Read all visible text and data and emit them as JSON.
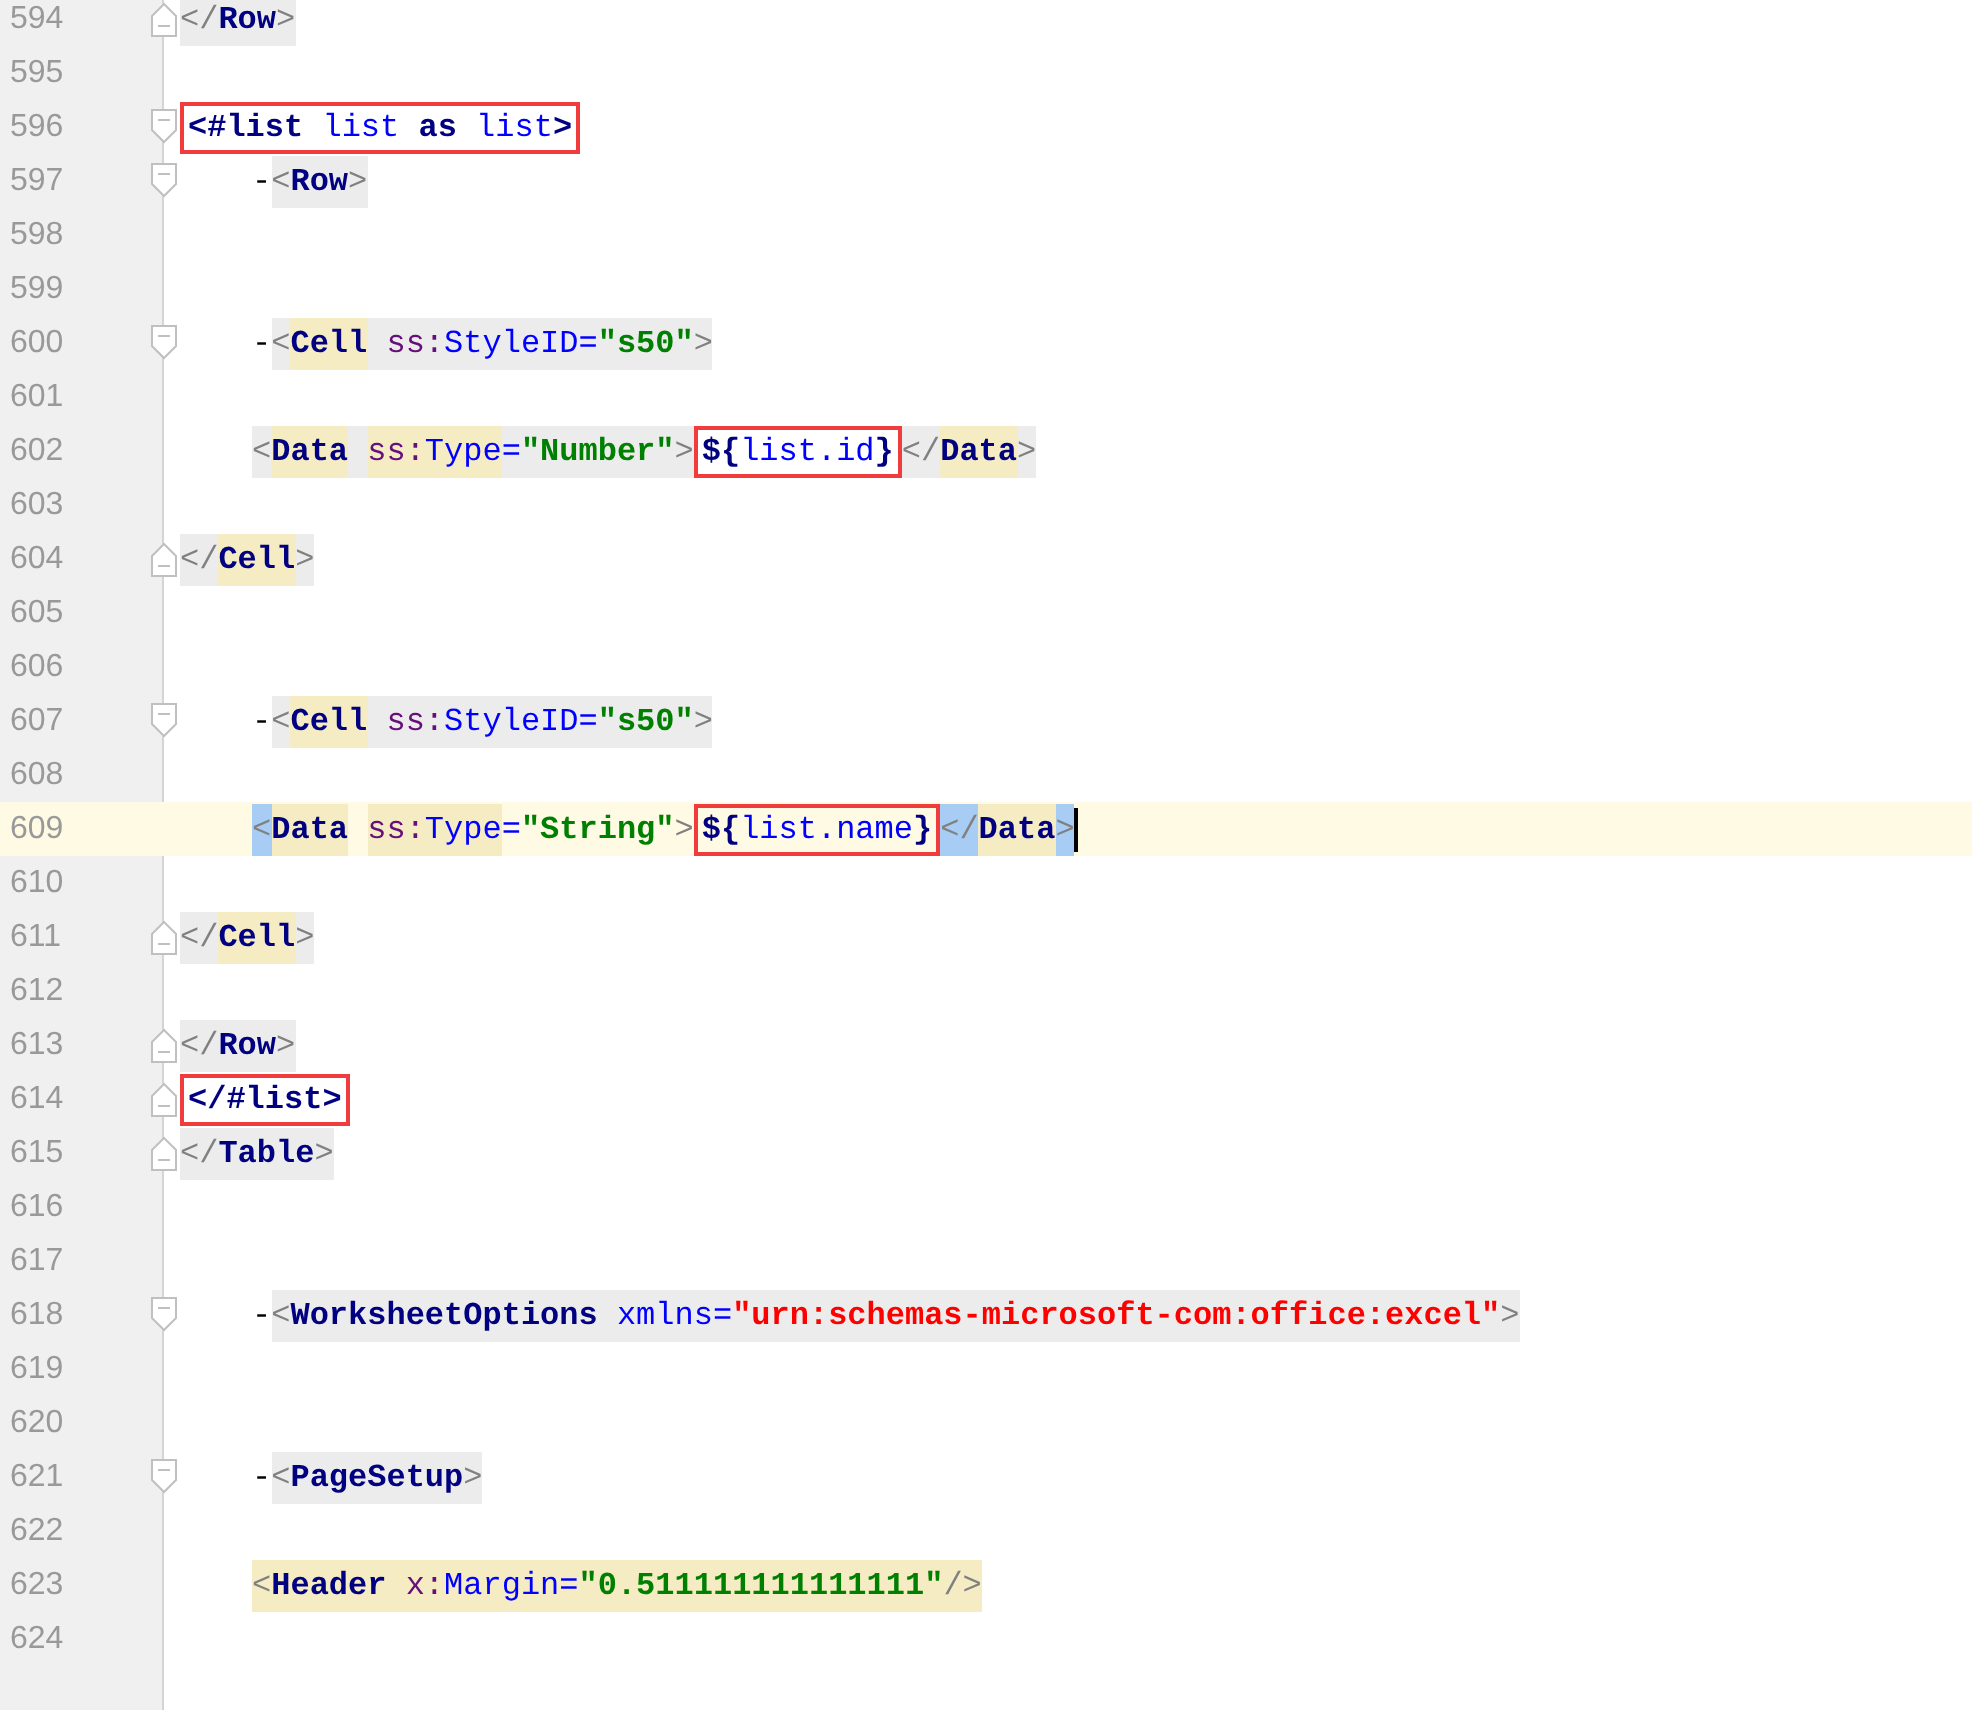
{
  "lines": [
    {
      "number": "594",
      "fold_close": true,
      "segments": [
        {
          "kind": "tag",
          "tokens": [
            {
              "text": "</",
              "kind": "punct"
            },
            {
              "text": "Row",
              "kind": "tag"
            },
            {
              "text": ">",
              "kind": "punct"
            }
          ]
        }
      ]
    },
    {
      "number": "595"
    },
    {
      "number": "596",
      "fold_open": true,
      "segments": [
        {
          "kind": "text",
          "boxed": true,
          "tokens": [
            {
              "text": "<#list ",
              "kind": "dir"
            },
            {
              "text": "list ",
              "kind": "expr"
            },
            {
              "text": "as ",
              "kind": "dir"
            },
            {
              "text": "list",
              "kind": "expr"
            },
            {
              "text": ">",
              "kind": "dir"
            }
          ]
        }
      ]
    },
    {
      "number": "597",
      "fold_open": true,
      "indented": true,
      "segments": [
        {
          "kind": "text",
          "tokens": [
            {
              "text": "-",
              "kind": "dash"
            }
          ]
        },
        {
          "kind": "tag",
          "tokens": [
            {
              "text": "<",
              "kind": "punct"
            },
            {
              "text": "Row",
              "kind": "tag"
            },
            {
              "text": ">",
              "kind": "punct"
            }
          ]
        }
      ]
    },
    {
      "number": "598"
    },
    {
      "number": "599"
    },
    {
      "number": "600",
      "fold_open": true,
      "indented": true,
      "segments": [
        {
          "kind": "text",
          "tokens": [
            {
              "text": "-",
              "kind": "dash"
            }
          ]
        },
        {
          "kind": "tag",
          "tokens": [
            {
              "text": "<",
              "kind": "punct"
            },
            {
              "text": "Cell",
              "kind": "tag",
              "matched": true
            },
            {
              "text": " ss:",
              "kind": "ns"
            },
            {
              "text": "StyleID=",
              "kind": "attr"
            },
            {
              "text": "\"s50\"",
              "kind": "value"
            },
            {
              "text": ">",
              "kind": "punct"
            }
          ]
        }
      ]
    },
    {
      "number": "601"
    },
    {
      "number": "602",
      "indented": true,
      "segments": [
        {
          "kind": "tag",
          "tokens": [
            {
              "text": "<",
              "kind": "punct"
            },
            {
              "text": "Data",
              "kind": "tag",
              "matched": true
            },
            {
              "text": "ss:",
              "kind": "ns",
              "matched": true,
              "spaced": true
            },
            {
              "text": "Type",
              "kind": "attr",
              "matched": true
            },
            {
              "text": "=",
              "kind": "attr"
            },
            {
              "text": "\"Number\"",
              "kind": "value"
            },
            {
              "text": ">",
              "kind": "punct"
            }
          ]
        },
        {
          "kind": "text",
          "boxed": true,
          "tokens": [
            {
              "text": "${",
              "kind": "dir"
            },
            {
              "text": "list.id",
              "kind": "expr"
            },
            {
              "text": "}",
              "kind": "dir"
            }
          ]
        },
        {
          "kind": "tag",
          "tokens": [
            {
              "text": "</",
              "kind": "punct"
            },
            {
              "text": "Data",
              "kind": "tag",
              "matched": true
            },
            {
              "text": ">",
              "kind": "punct"
            }
          ]
        }
      ]
    },
    {
      "number": "603"
    },
    {
      "number": "604",
      "fold_close": true,
      "segments": [
        {
          "kind": "tag",
          "tokens": [
            {
              "text": "</",
              "kind": "punct"
            },
            {
              "text": "Cell",
              "kind": "tag",
              "matched": true
            },
            {
              "text": ">",
              "kind": "punct"
            }
          ]
        }
      ]
    },
    {
      "number": "605"
    },
    {
      "number": "606"
    },
    {
      "number": "607",
      "fold_open": true,
      "indented": true,
      "segments": [
        {
          "kind": "text",
          "tokens": [
            {
              "text": "-",
              "kind": "dash"
            }
          ]
        },
        {
          "kind": "tag",
          "tokens": [
            {
              "text": "<",
              "kind": "punct"
            },
            {
              "text": "Cell",
              "kind": "tag",
              "matched": true
            },
            {
              "text": " ss:",
              "kind": "ns"
            },
            {
              "text": "StyleID=",
              "kind": "attr"
            },
            {
              "text": "\"s50\"",
              "kind": "value"
            },
            {
              "text": ">",
              "kind": "punct"
            }
          ]
        }
      ]
    },
    {
      "number": "608"
    },
    {
      "number": "609",
      "current": true,
      "indented": true,
      "segments": [
        {
          "kind": "text",
          "tokens": [
            {
              "text": "<",
              "kind": "punct",
              "bracket_match": true
            },
            {
              "text": "Data",
              "kind": "tag",
              "matched": true
            },
            {
              "text": "ss:",
              "kind": "ns",
              "matched": true,
              "spaced": true
            },
            {
              "text": "Type",
              "kind": "attr",
              "matched": true
            },
            {
              "text": "=",
              "kind": "attr"
            },
            {
              "text": "\"String\"",
              "kind": "value"
            },
            {
              "text": ">",
              "kind": "punct"
            }
          ]
        },
        {
          "kind": "text",
          "boxed": true,
          "tokens": [
            {
              "text": "${",
              "kind": "dir"
            },
            {
              "text": "list.name",
              "kind": "expr"
            },
            {
              "text": "}",
              "kind": "dir"
            }
          ]
        },
        {
          "kind": "text",
          "tokens": [
            {
              "text": "</",
              "kind": "punct",
              "bracket_match": true
            },
            {
              "text": "Data",
              "kind": "tag",
              "matched": true
            },
            {
              "text": ">",
              "kind": "punct",
              "bracket_match": true
            }
          ]
        }
      ]
    },
    {
      "number": "610"
    },
    {
      "number": "611",
      "fold_close": true,
      "segments": [
        {
          "kind": "tag",
          "tokens": [
            {
              "text": "</",
              "kind": "punct"
            },
            {
              "text": "Cell",
              "kind": "tag",
              "matched": true
            },
            {
              "text": ">",
              "kind": "punct"
            }
          ]
        }
      ]
    },
    {
      "number": "612"
    },
    {
      "number": "613",
      "fold_close": true,
      "segments": [
        {
          "kind": "tag",
          "tokens": [
            {
              "text": "</",
              "kind": "punct"
            },
            {
              "text": "Row",
              "kind": "tag"
            },
            {
              "text": ">",
              "kind": "punct"
            }
          ]
        }
      ]
    },
    {
      "number": "614",
      "fold_close": true,
      "segments": [
        {
          "kind": "text",
          "boxed": true,
          "tokens": [
            {
              "text": "</#list>",
              "kind": "dir"
            }
          ]
        }
      ]
    },
    {
      "number": "615",
      "fold_close": true,
      "segments": [
        {
          "kind": "tag",
          "tokens": [
            {
              "text": "</",
              "kind": "punct"
            },
            {
              "text": "Table",
              "kind": "tag"
            },
            {
              "text": ">",
              "kind": "punct"
            }
          ]
        }
      ]
    },
    {
      "number": "616"
    },
    {
      "number": "617"
    },
    {
      "number": "618",
      "fold_open": true,
      "indented": true,
      "segments": [
        {
          "kind": "text",
          "tokens": [
            {
              "text": "-",
              "kind": "dash"
            }
          ]
        },
        {
          "kind": "tag",
          "tokens": [
            {
              "text": "<",
              "kind": "punct"
            },
            {
              "text": "WorksheetOptions",
              "kind": "tag"
            },
            {
              "text": " xmlns=",
              "kind": "attr"
            },
            {
              "text": "\"urn:schemas-microsoft-com:office:excel\"",
              "kind": "url"
            },
            {
              "text": ">",
              "kind": "punct"
            }
          ]
        }
      ]
    },
    {
      "number": "619"
    },
    {
      "number": "620"
    },
    {
      "number": "621",
      "fold_open": true,
      "indented": true,
      "segments": [
        {
          "kind": "text",
          "tokens": [
            {
              "text": "-",
              "kind": "dash"
            }
          ]
        },
        {
          "kind": "tag",
          "tokens": [
            {
              "text": "<",
              "kind": "punct"
            },
            {
              "text": "PageSetup",
              "kind": "tag"
            },
            {
              "text": ">",
              "kind": "punct"
            }
          ]
        }
      ]
    },
    {
      "number": "622"
    },
    {
      "number": "623",
      "indented": true,
      "segments": [
        {
          "kind": "matched_tag",
          "tokens": [
            {
              "text": "<",
              "kind": "punct"
            },
            {
              "text": "Header",
              "kind": "tag"
            },
            {
              "text": " x:",
              "kind": "ns"
            },
            {
              "text": "Margin=",
              "kind": "attr"
            },
            {
              "text": "\"0.511111111111111\"",
              "kind": "value"
            },
            {
              "text": "/>",
              "kind": "punct"
            }
          ]
        }
      ]
    },
    {
      "number": "624"
    }
  ]
}
